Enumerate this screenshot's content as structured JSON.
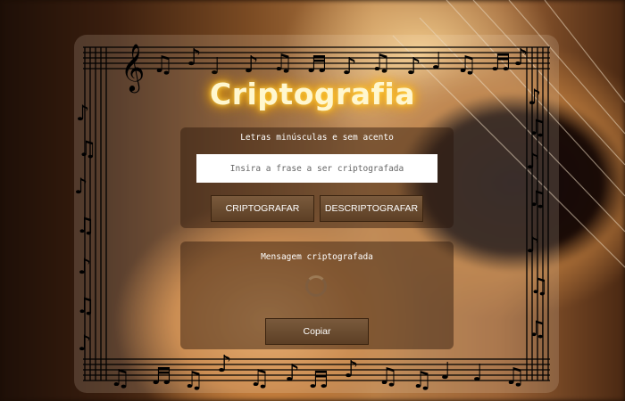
{
  "app": {
    "title": "Criptografia"
  },
  "encrypt_panel": {
    "hint": "Letras minúsculas e sem acento",
    "input_placeholder": "Insira a frase a ser criptografada",
    "input_value": "",
    "encrypt_label": "CRIPTOGRAFAR",
    "decrypt_label": "DESCRIPTOGRAFAR"
  },
  "result_panel": {
    "label": "Mensagem criptografada",
    "copy_label": "Copiar"
  },
  "icons": {
    "spinner": "loading-spinner-icon",
    "frame": "music-staff-frame-icon"
  },
  "colors": {
    "title_glow": "#ffb800",
    "button_bg": "#6a4b2f",
    "panel_bg": "#28140873"
  }
}
